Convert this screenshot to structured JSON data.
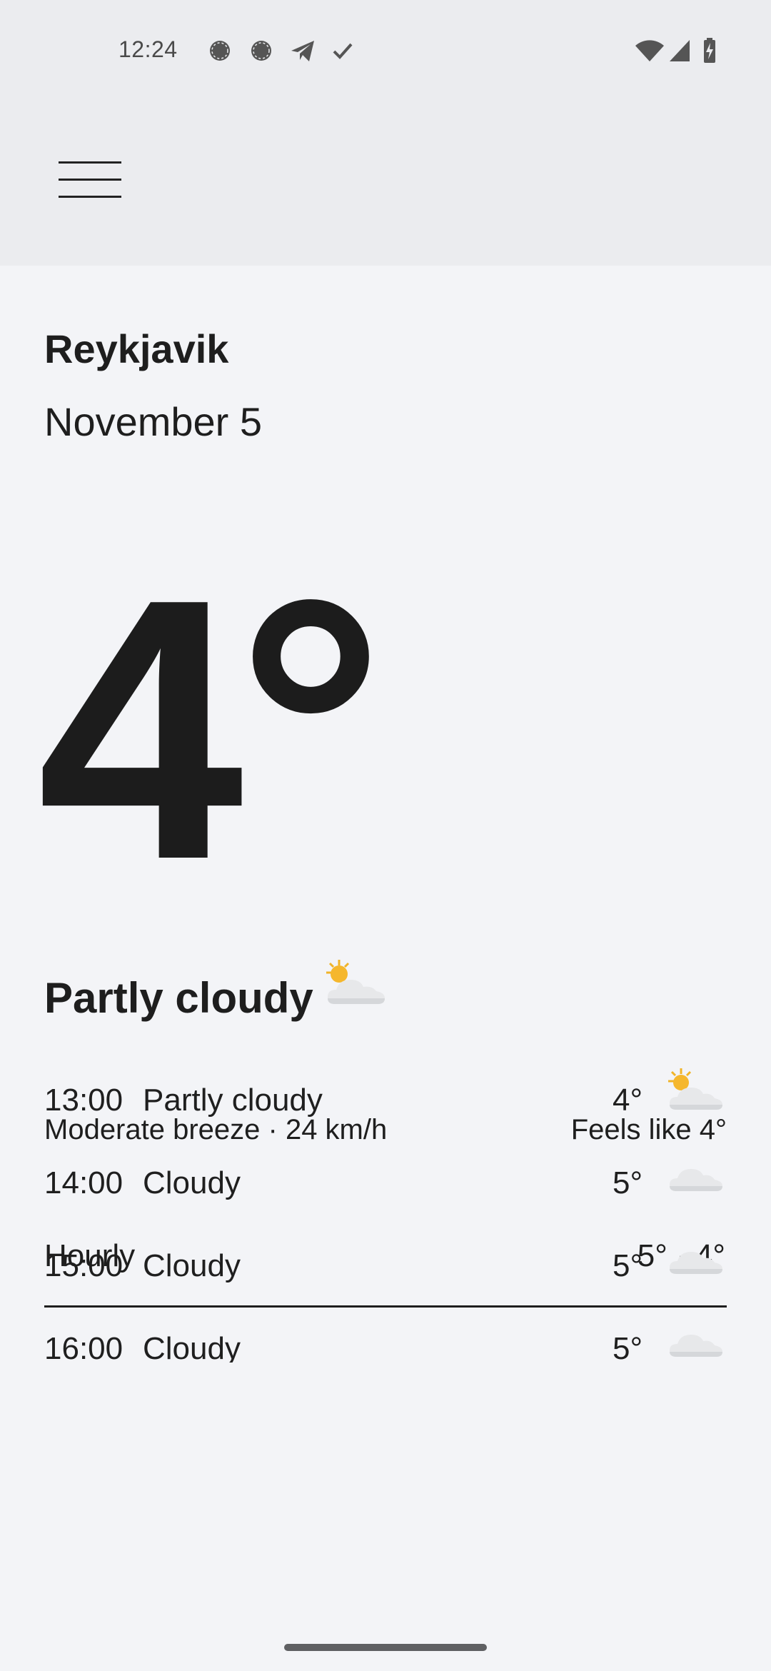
{
  "status_bar": {
    "time": "12:24",
    "notification_icons": [
      "chat-bubble-icon",
      "chat-bubble-icon",
      "telegram-icon",
      "check-icon"
    ],
    "system_icons": [
      "wifi-icon",
      "cell-signal-icon",
      "battery-charging-icon"
    ]
  },
  "header": {
    "menu_icon": "hamburger-menu-icon"
  },
  "location": {
    "city": "Reykjavik",
    "date": "November 5"
  },
  "current": {
    "temperature": "4°",
    "condition": "Partly cloudy",
    "condition_icon": "partly-cloudy-icon",
    "wind": "Moderate breeze · 24 km/h",
    "feels_like": "Feels like 4°"
  },
  "hourly": {
    "label": "Hourly",
    "range": "5° · 4°",
    "items": [
      {
        "time": "13:00",
        "condition": "Partly cloudy",
        "temp": "4°",
        "icon": "partly-cloudy-icon"
      },
      {
        "time": "14:00",
        "condition": "Cloudy",
        "temp": "5°",
        "icon": "cloud-icon"
      },
      {
        "time": "15:00",
        "condition": "Cloudy",
        "temp": "5°",
        "icon": "cloud-icon"
      },
      {
        "time": "16:00",
        "condition": "Cloudy",
        "temp": "5°",
        "icon": "cloud-icon"
      }
    ]
  },
  "colors": {
    "background": "#f3f4f7",
    "topbar": "#ebecef",
    "text": "#1e1e1e"
  }
}
